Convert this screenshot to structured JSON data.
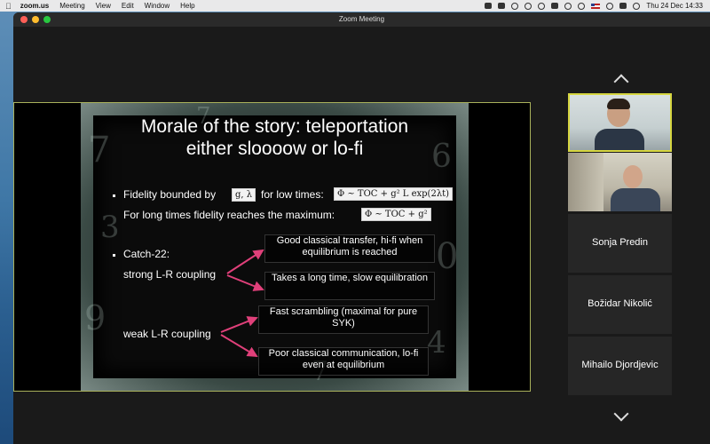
{
  "menubar": {
    "app_name": "zoom.us",
    "menus": [
      "Meeting",
      "View",
      "Edit",
      "Window",
      "Help"
    ],
    "clock": "Thu 24 Dec  14:33"
  },
  "window": {
    "title": "Zoom Meeting"
  },
  "slide": {
    "title_line1": "Morale of the story: teleportation",
    "title_line2": "either sloooow or lo-fi",
    "bullet1_a": "Fidelity bounded by",
    "bullet1_formula_a": "g, λ",
    "bullet1_b": "for low times:",
    "bullet1_formula_b": "Φ ~ TOC + g² L exp(2λt)",
    "bullet1_line2": "For long times fidelity reaches the maximum:",
    "bullet1_formula_c": "Φ ~ TOC + g²",
    "bullet2": "Catch-22:",
    "strong": "strong L-R coupling",
    "weak": "weak L-R coupling",
    "box1": "Good classical transfer, hi-fi when equilibrium is reached",
    "box2": "Takes a long time, slow equilibration",
    "box3": "Fast scrambling (maximal for pure SYK)",
    "box4": "Poor classical communication, lo-fi even at equilibrium",
    "arrow_color": "#e0407a"
  },
  "participants": [
    {
      "name": "Sonja Predin"
    },
    {
      "name": "Božidar Nikolić"
    },
    {
      "name": "Mihailo Djordjevic"
    }
  ],
  "colors": {
    "active_speaker_border": "#d6d640",
    "share_border": "#a9b15b"
  }
}
